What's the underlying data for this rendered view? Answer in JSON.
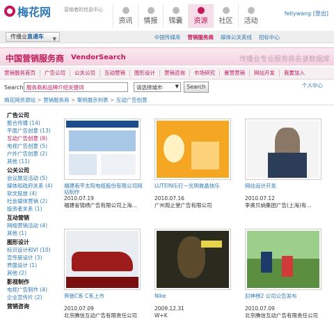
{
  "header": {
    "logo_text": "梅花网",
    "slogan": "营销者的信息中心",
    "nav": [
      {
        "label": "资讯",
        "icon": "news-icon",
        "active": false
      },
      {
        "label": "情报",
        "icon": "intel-icon",
        "active": false
      },
      {
        "label": "锦囊",
        "icon": "tips-icon",
        "active": false
      },
      {
        "label": "资源",
        "icon": "resource-icon",
        "active": true
      },
      {
        "label": "社区",
        "icon": "community-icon",
        "active": false
      },
      {
        "label": "活动",
        "icon": "event-icon",
        "active": false
      }
    ],
    "user": "fellywang",
    "logout": "[登出]"
  },
  "subbar": {
    "dropdown_prefix": "传播业",
    "dropdown_bold": "直通车",
    "links": [
      {
        "label": "中国传媒库",
        "active": false
      },
      {
        "label": "营销服务商",
        "active": true
      },
      {
        "label": "媒体公关英线",
        "active": false
      },
      {
        "label": "招标中心",
        "active": false
      }
    ]
  },
  "titleband": {
    "title_cn": "中国营销服务商",
    "title_en": "VendorSearch",
    "tagline": "传播业专业服务商名录数据库"
  },
  "cattabs": [
    "营销服务首页",
    "广告公司",
    "公关公司",
    "互动营销",
    "图形设计",
    "营销咨询",
    "市场研究",
    "置营营销",
    "网站开发",
    "我要加入"
  ],
  "search": {
    "label": "Search",
    "input_value": "服务商和品牌介绍关键词",
    "select_value": "请选择城市",
    "button": "Search",
    "personal": "个人中心",
    "personal_sub": ""
  },
  "breadcrumb": [
    "梅花网资源站",
    "营销服务商",
    "案例展示列表",
    "互动广告创意"
  ],
  "sidebar": [
    {
      "type": "head",
      "label": "广告公司"
    },
    {
      "type": "item",
      "label": "整合传播 (14)"
    },
    {
      "type": "item",
      "label": "平面广告创意 (13)"
    },
    {
      "type": "item",
      "label": "互动广告创意 (9)",
      "active": true
    },
    {
      "type": "item",
      "label": "电视广告创意 (5)"
    },
    {
      "type": "item",
      "label": "户外广告创意 (2)"
    },
    {
      "type": "item",
      "label": "其他 (11)"
    },
    {
      "type": "head",
      "label": "公关公司"
    },
    {
      "type": "item",
      "label": "会议展览活动 (5)"
    },
    {
      "type": "item",
      "label": "媒体和政府关系 (4)"
    },
    {
      "type": "item",
      "label": "软文投放 (4)"
    },
    {
      "type": "item",
      "label": "社会媒体营销 (2)"
    },
    {
      "type": "item",
      "label": "投资者关系 (1)"
    },
    {
      "type": "head",
      "label": "互动营销"
    },
    {
      "type": "item",
      "label": "网络营销活动 (4)"
    },
    {
      "type": "item",
      "label": "其他 (1)"
    },
    {
      "type": "head",
      "label": "图形设计"
    },
    {
      "type": "item",
      "label": "标识设计和VI (10)"
    },
    {
      "type": "item",
      "label": "宣传册设计 (3)"
    },
    {
      "type": "item",
      "label": "界面设计 (1)"
    },
    {
      "type": "item",
      "label": "其他 (2)"
    },
    {
      "type": "head",
      "label": "影视制作"
    },
    {
      "type": "item",
      "label": "电视广告制作 (4)"
    },
    {
      "type": "item",
      "label": "企业宣传片 (2)"
    },
    {
      "type": "head",
      "label": "营销咨询"
    }
  ],
  "cases": [
    {
      "title": "福建南平太阳电缆股份有限公司网站制作",
      "date": "2010.07.19",
      "company": "福建省锦绣广告有限公司上海..."
    },
    {
      "title": "LUTEIN乐钉一光明救晶快乐",
      "date": "2010.07.16",
      "company": "广州观止堂广告有限公司"
    },
    {
      "title": "网站设计开发",
      "date": "2010.07.12",
      "company": "李奥贝纳集团广告(上海)有..."
    },
    {
      "title": "奔驰C系 C系上市",
      "date": "2010.07.09",
      "company": "北京腾信互动广告有限责任公司"
    },
    {
      "title": "Nike",
      "date": "2009.12.31",
      "company": "W+K"
    },
    {
      "title": "封神榜2 公司公告发布",
      "date": "2010.07.09",
      "company": "北京腾信互动广告有限责任公司"
    }
  ],
  "colors": {
    "brand": "#c2185b",
    "link": "#2f7ab9"
  }
}
